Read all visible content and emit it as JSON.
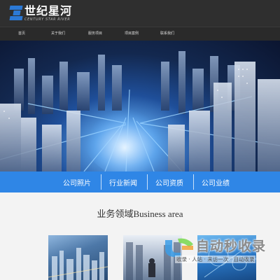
{
  "brand": {
    "name_cn": "世纪星河",
    "name_en": "CENTURY STAR RIVER",
    "accent": "#2b79d6"
  },
  "nav": {
    "items": [
      "首页",
      "关于我们",
      "服务项目",
      "项目案例",
      "联系我们"
    ]
  },
  "tabs": {
    "items": [
      "公司照片",
      "行业新闻",
      "公司资质",
      "公司业绩"
    ],
    "background": "#2f86e6"
  },
  "section": {
    "title": "业务领域Business area"
  },
  "watermark": {
    "title": "自动秒收录",
    "subtitle": "收录 · 人站 · 来访一次 · 自动收录"
  }
}
